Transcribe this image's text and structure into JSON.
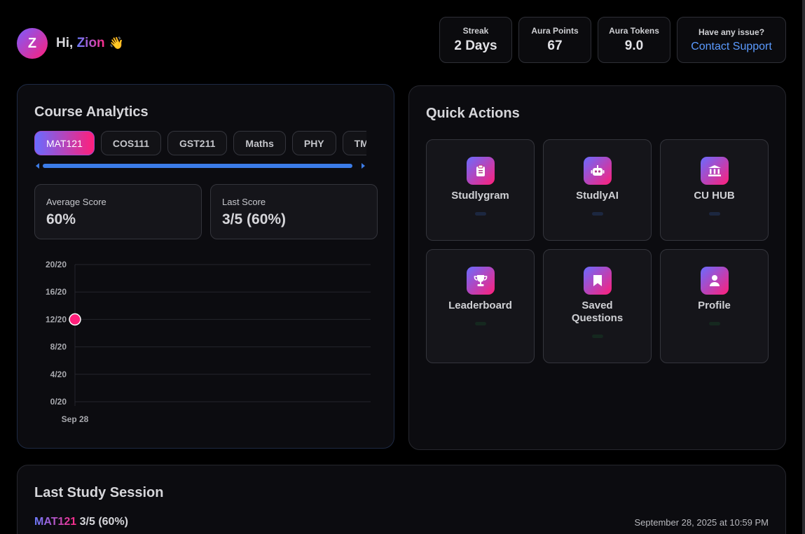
{
  "user": {
    "initial": "Z",
    "greeting": "Hi,",
    "name": "Zion",
    "wave": "👋"
  },
  "stats": [
    {
      "label": "Streak",
      "value": "2 Days"
    },
    {
      "label": "Aura Points",
      "value": "67"
    },
    {
      "label": "Aura Tokens",
      "value": "9.0"
    }
  ],
  "support": {
    "label": "Have any issue?",
    "link": "Contact Support"
  },
  "analytics": {
    "title": "Course Analytics",
    "tabs": [
      "MAT121",
      "COS111",
      "GST211",
      "Maths",
      "PHY",
      "TMC"
    ],
    "active_tab": "MAT121",
    "average_label": "Average Score",
    "average_value": "60%",
    "last_label": "Last Score",
    "last_value": "3/5 (60%)"
  },
  "chart_data": {
    "type": "line",
    "x": [
      "Sep 28"
    ],
    "series": [
      {
        "values": [
          12
        ]
      }
    ],
    "y_ticks": [
      "0/20",
      "4/20",
      "8/20",
      "12/20",
      "16/20",
      "20/20"
    ],
    "ylim": [
      0,
      20
    ],
    "grid": true,
    "point_color": "#ff1f7a"
  },
  "quick_actions": {
    "title": "Quick Actions",
    "items": [
      {
        "label": "Studlygram",
        "icon": "clipboard-icon",
        "pill": "#1c2740"
      },
      {
        "label": "StudlyAI",
        "icon": "robot-icon",
        "pill": "#1c2740"
      },
      {
        "label": "CU HUB",
        "icon": "institution-icon",
        "pill": "#1c2740"
      },
      {
        "label": "Leaderboard",
        "icon": "trophy-icon",
        "pill": "#15281f"
      },
      {
        "label": "Saved\nQuestions",
        "icon": "bookmark-icon",
        "pill": "#15281f"
      },
      {
        "label": "Profile",
        "icon": "user-icon",
        "pill": "#15281f"
      }
    ]
  },
  "session": {
    "title": "Last Study Session",
    "course": "MAT121",
    "score": "3/5 (60%)",
    "date": "September 28, 2025 at 10:59 PM"
  },
  "colors": {
    "accent_start": "#6a6bff",
    "accent_end": "#ff1f7a",
    "link": "#5b9bff"
  }
}
